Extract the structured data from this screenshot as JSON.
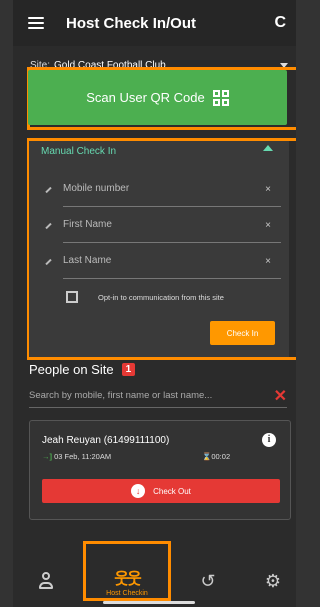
{
  "header": {
    "title": "Host Check In/Out",
    "refresh_glyph": "C"
  },
  "site": {
    "label": "Site:",
    "value": "Gold Coast Football Club"
  },
  "scan": {
    "label": "Scan User QR Code"
  },
  "manual": {
    "title": "Manual Check In",
    "fields": [
      {
        "placeholder": "Mobile number",
        "clear": "×"
      },
      {
        "placeholder": "First Name",
        "clear": "×"
      },
      {
        "placeholder": "Last Name",
        "clear": "×"
      }
    ],
    "optin_label": "Opt-in to communication from this site",
    "optin_checked": false,
    "checkin_label": "Check In"
  },
  "people": {
    "title": "People on Site",
    "count": "1",
    "search_placeholder": "Search by mobile, first name or last name...",
    "clear_glyph": "✕",
    "entries": [
      {
        "name": "Jeah Reuyan (61499111100)",
        "time_in": "03 Feb, 11:20AM",
        "duration": "00:02",
        "checkout_label": "Check Out"
      }
    ]
  },
  "nav": {
    "host_checkin_label": "Host Checkin",
    "history_glyph": "↺",
    "settings_glyph": "⚙",
    "active": "host-checkin"
  },
  "colors": {
    "accent": "#ff9800",
    "green": "#4caf50",
    "red": "#e53935",
    "teal": "#66d9b0",
    "highlight": "#ff8c00"
  }
}
